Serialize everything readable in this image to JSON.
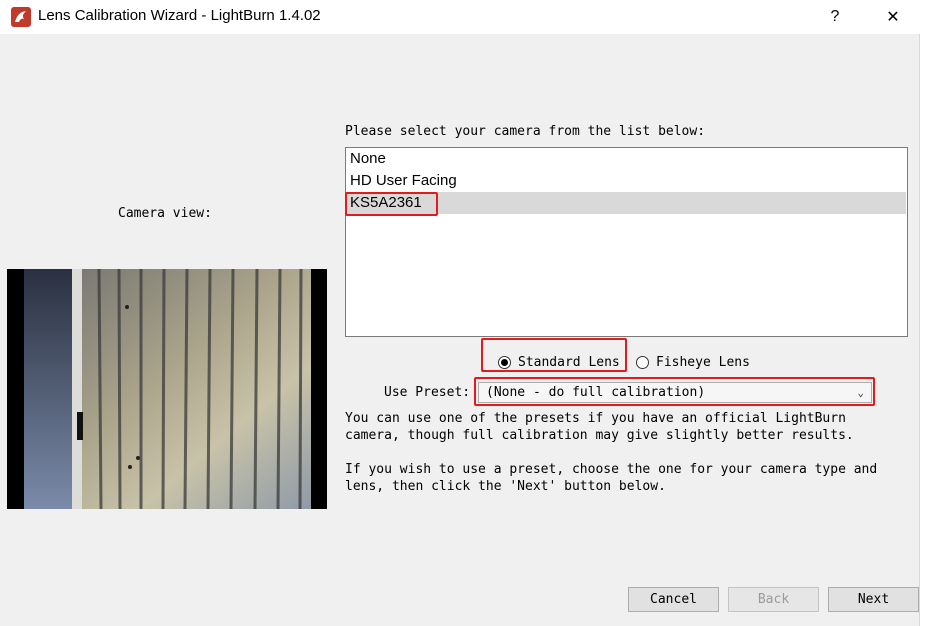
{
  "window": {
    "title": "Lens Calibration Wizard - LightBurn 1.4.02",
    "help_label": "?",
    "close_label": "✕"
  },
  "camera_view": {
    "label": "Camera view:"
  },
  "camera_list": {
    "label": "Please select your camera from the list below:",
    "items": [
      "None",
      "HD User Facing",
      "KS5A2361"
    ],
    "selected": "KS5A2361"
  },
  "lens": {
    "options": [
      "Standard Lens",
      "Fisheye Lens"
    ],
    "selected": "Standard Lens"
  },
  "preset": {
    "label": "Use Preset:",
    "value": "(None - do full calibration)"
  },
  "descriptions": {
    "p1": "You can use one of the presets if you have an official LightBurn\ncamera, though full calibration may give slightly better results.",
    "p2": "If you wish to use a preset, choose the one for your camera type and\nlens, then click the 'Next' button below."
  },
  "buttons": {
    "cancel": "Cancel",
    "back": "Back",
    "next": "Next"
  },
  "colors": {
    "highlight": "#e11c1c",
    "app_icon": "#c0392b"
  }
}
